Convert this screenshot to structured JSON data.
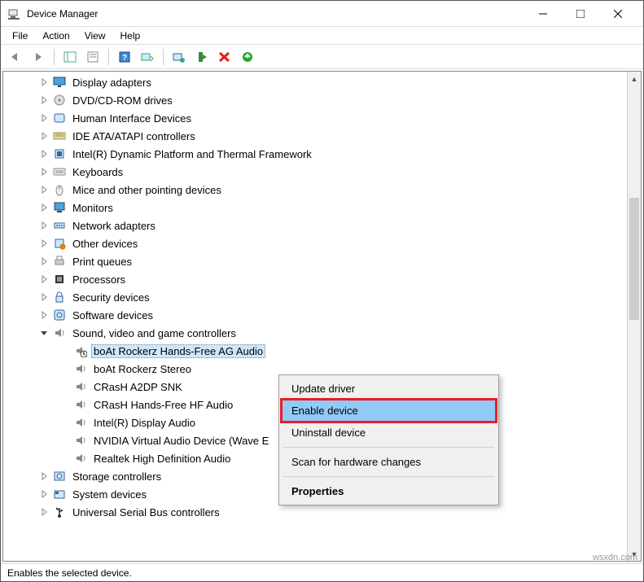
{
  "window": {
    "title": "Device Manager"
  },
  "menu": {
    "file": "File",
    "action": "Action",
    "view": "View",
    "help": "Help"
  },
  "status": {
    "text": "Enables the selected device."
  },
  "watermark": "wsxdn.com",
  "tree": {
    "items": [
      {
        "label": "Display adapters",
        "icon": "display",
        "expander": ">",
        "selected": false
      },
      {
        "label": "DVD/CD-ROM drives",
        "icon": "cd",
        "expander": ">",
        "selected": false
      },
      {
        "label": "Human Interface Devices",
        "icon": "hid",
        "expander": ">",
        "selected": false
      },
      {
        "label": "IDE ATA/ATAPI controllers",
        "icon": "ide",
        "expander": ">",
        "selected": false
      },
      {
        "label": "Intel(R) Dynamic Platform and Thermal Framework",
        "icon": "chip",
        "expander": ">",
        "selected": false
      },
      {
        "label": "Keyboards",
        "icon": "keyboard",
        "expander": ">",
        "selected": false
      },
      {
        "label": "Mice and other pointing devices",
        "icon": "mouse",
        "expander": ">",
        "selected": false
      },
      {
        "label": "Monitors",
        "icon": "monitor",
        "expander": ">",
        "selected": false
      },
      {
        "label": "Network adapters",
        "icon": "network",
        "expander": ">",
        "selected": false
      },
      {
        "label": "Other devices",
        "icon": "other",
        "expander": ">",
        "selected": false
      },
      {
        "label": "Print queues",
        "icon": "printer",
        "expander": ">",
        "selected": false
      },
      {
        "label": "Processors",
        "icon": "cpu",
        "expander": ">",
        "selected": false
      },
      {
        "label": "Security devices",
        "icon": "security",
        "expander": ">",
        "selected": false
      },
      {
        "label": "Software devices",
        "icon": "software",
        "expander": ">",
        "selected": false
      },
      {
        "label": "Sound, video and game controllers",
        "icon": "sound",
        "expander": "v",
        "selected": false
      }
    ],
    "children": [
      {
        "label": "boAt Rockerz Hands-Free AG Audio",
        "icon": "speaker-disabled",
        "selected": true
      },
      {
        "label": "boAt Rockerz Stereo",
        "icon": "speaker",
        "selected": false
      },
      {
        "label": "CRasH A2DP SNK",
        "icon": "speaker",
        "selected": false
      },
      {
        "label": "CRasH Hands-Free HF Audio",
        "icon": "speaker",
        "selected": false
      },
      {
        "label": "Intel(R) Display Audio",
        "icon": "speaker",
        "selected": false
      },
      {
        "label": "NVIDIA Virtual Audio Device (Wave E",
        "icon": "speaker",
        "selected": false
      },
      {
        "label": "Realtek High Definition Audio",
        "icon": "speaker",
        "selected": false
      }
    ],
    "items2": [
      {
        "label": "Storage controllers",
        "icon": "storage",
        "expander": ">",
        "selected": false
      },
      {
        "label": "System devices",
        "icon": "system",
        "expander": ">",
        "selected": false
      },
      {
        "label": "Universal Serial Bus controllers",
        "icon": "usb",
        "expander": ">",
        "selected": false
      }
    ]
  },
  "ctx": {
    "update": "Update driver",
    "enable": "Enable device",
    "uninstall": "Uninstall device",
    "scan": "Scan for hardware changes",
    "properties": "Properties"
  }
}
